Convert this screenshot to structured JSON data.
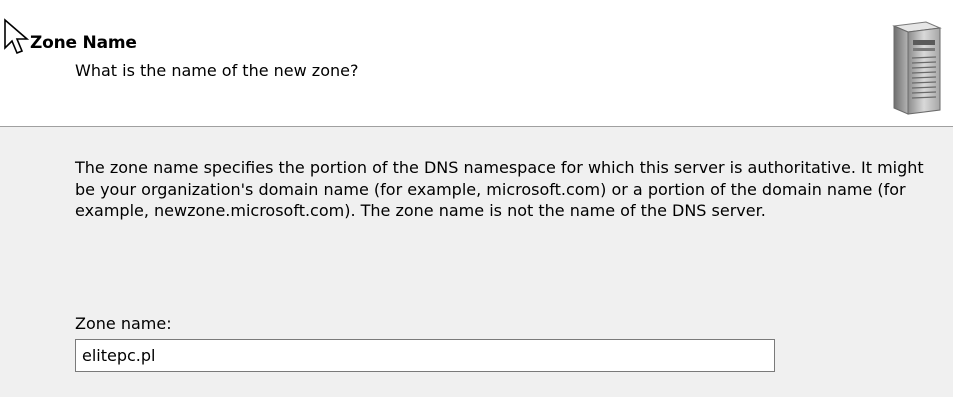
{
  "header": {
    "title": "Zone Name",
    "subtitle": "What is the name of the new zone?",
    "icon": "server-icon"
  },
  "main": {
    "description": "The zone name specifies the portion of the DNS namespace for which this server is authoritative. It might be your organization's domain name (for example,  microsoft.com) or a portion of the domain name (for example, newzone.microsoft.com). The zone name is not the name of the DNS server.",
    "zone_name_label": "Zone name:",
    "zone_name_value": "elitepc.pl"
  },
  "cursor": {
    "icon": "mouse-pointer-icon"
  }
}
